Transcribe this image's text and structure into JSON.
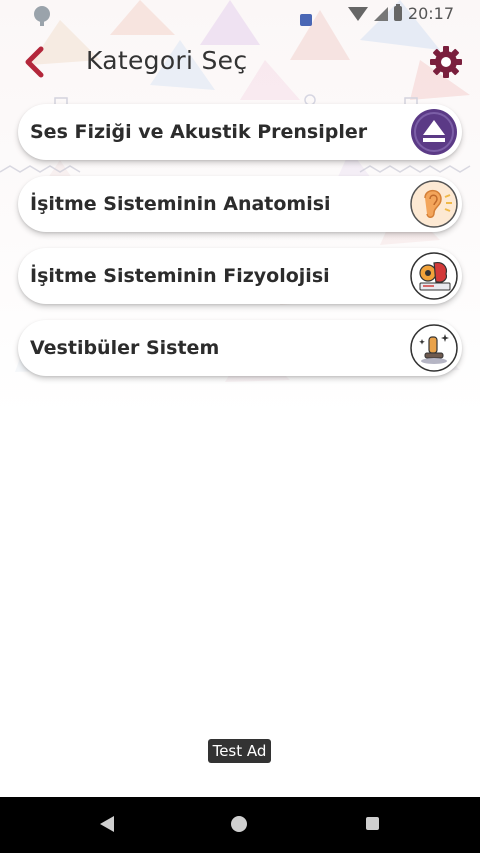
{
  "status_bar": {
    "time": "20:17",
    "icons": [
      "location-pin-icon",
      "notification-square-icon",
      "wifi-icon",
      "signal-icon",
      "battery-icon"
    ]
  },
  "app_bar": {
    "title": "Kategori Seç",
    "back_icon": "chevron-left-icon",
    "settings_icon": "gear-icon"
  },
  "categories": [
    {
      "label": "Ses Fiziği ve Akustik Prensipler",
      "icon": "eject-triangle-icon"
    },
    {
      "label": "İşitme Sisteminin Anatomisi",
      "icon": "ear-icon"
    },
    {
      "label": "İşitme Sisteminin Fizyolojisi",
      "icon": "brain-gear-icon"
    },
    {
      "label": "Vestibüler Sistem",
      "icon": "balance-sparkle-icon"
    }
  ],
  "ad": {
    "label": "Test Ad"
  },
  "nav_bar": {
    "icons": [
      "nav-back-icon",
      "nav-home-icon",
      "nav-recents-icon"
    ]
  },
  "colors": {
    "accent": "#b3273b",
    "settings": "#7a1f3d",
    "purple_icon": "#5b3a86",
    "navbar": "#000000"
  }
}
